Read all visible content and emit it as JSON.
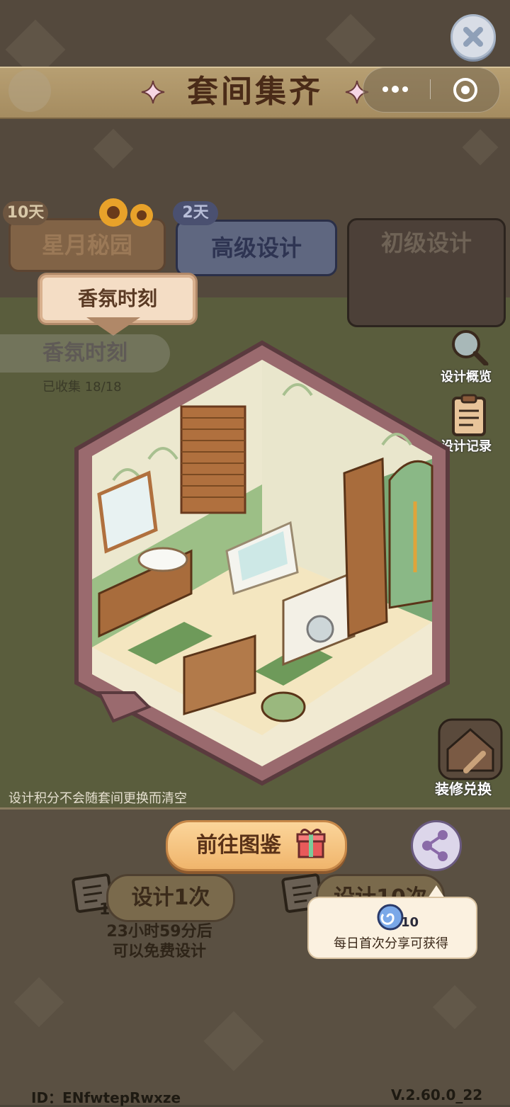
{
  "header": {
    "title": "套间集齐",
    "close_icon": "close-icon",
    "menu_icon": "more-dots-icon",
    "exit_icon": "target-icon"
  },
  "tabs": [
    {
      "label": "星月秘园",
      "days": "10天",
      "state": "faded"
    },
    {
      "label": "高级设计",
      "days": "2天",
      "state": "inactive"
    },
    {
      "label": "初级设计",
      "state": "inactive"
    }
  ],
  "subtab": {
    "label": "香氛时刻"
  },
  "collection": {
    "name": "香氛时刻",
    "progress_label": "已收集 18/18",
    "collected": 18,
    "total": 18
  },
  "side_buttons": {
    "overview": "设计概览",
    "record": "设计记录",
    "exchange": "装修兑换"
  },
  "notice": "设计积分不会随套间更换而清空",
  "actions": {
    "catalog": "前往图鉴",
    "design_once": "设计1次",
    "design_ten": "设计10次",
    "scroll_count": "1",
    "free_timer": "23小时59分后",
    "free_text": "可以免费设计"
  },
  "tooltip": {
    "count": "10",
    "text": "每日首次分享可获得"
  },
  "footer": {
    "id": "ID：ENfwtepRwxze",
    "version": "V.2.60.0_22"
  },
  "colors": {
    "banner": "#b79f72",
    "title_text": "#4a2b18",
    "catalog_button": "#f0b56c",
    "room_frame": "#9a6a6e"
  }
}
